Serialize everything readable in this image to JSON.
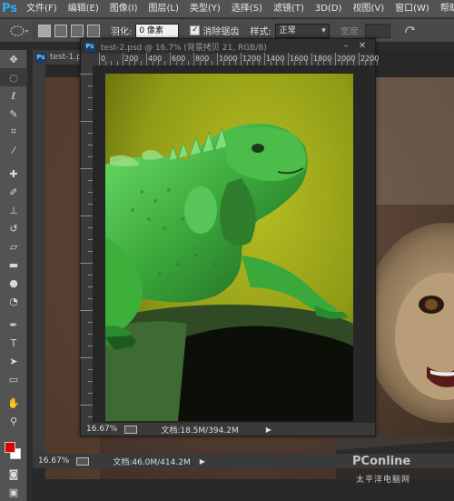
{
  "app": {
    "logo": "Ps"
  },
  "menu": [
    "文件(F)",
    "编辑(E)",
    "图像(I)",
    "图层(L)",
    "类型(Y)",
    "选择(S)",
    "滤镜(T)",
    "3D(D)",
    "视图(V)",
    "窗口(W)",
    "帮助(H)"
  ],
  "options": {
    "feather_label": "羽化:",
    "feather_value": "0 像素",
    "antialias_label": "消除锯齿",
    "style_label": "样式:",
    "style_value": "正常",
    "width_label": "宽度:"
  },
  "background_doc": {
    "tab": "test-1.p",
    "zoom": "16.67%",
    "doc_info": "文档:46.0M/414.2M"
  },
  "floating_doc": {
    "title": "test-2.psd @ 16.7% (背景拷贝 21, RGB/8)",
    "ruler_labels": [
      "0",
      "200",
      "400",
      "600",
      "800",
      "1000",
      "1200",
      "1400",
      "1600",
      "1800",
      "2000",
      "2200"
    ],
    "zoom": "16.67%",
    "doc_info": "文档:18.5M/394.2M"
  },
  "watermark": {
    "brand": "PConline",
    "sub": "太平洋电脑网"
  },
  "colors": {
    "foreground": "#e00000",
    "background": "#ffffff",
    "iguana_green": "#4ec24e",
    "wall_yellow": "#9ea818"
  },
  "icons": [
    "move-icon",
    "marquee-icon",
    "lasso-icon",
    "quick-select-icon",
    "crop-icon",
    "eyedropper-icon",
    "healing-icon",
    "brush-icon",
    "stamp-icon",
    "history-brush-icon",
    "eraser-icon",
    "gradient-icon",
    "blur-icon",
    "dodge-icon",
    "pen-icon",
    "type-icon",
    "path-select-icon",
    "shape-icon",
    "hand-icon",
    "zoom-icon"
  ]
}
